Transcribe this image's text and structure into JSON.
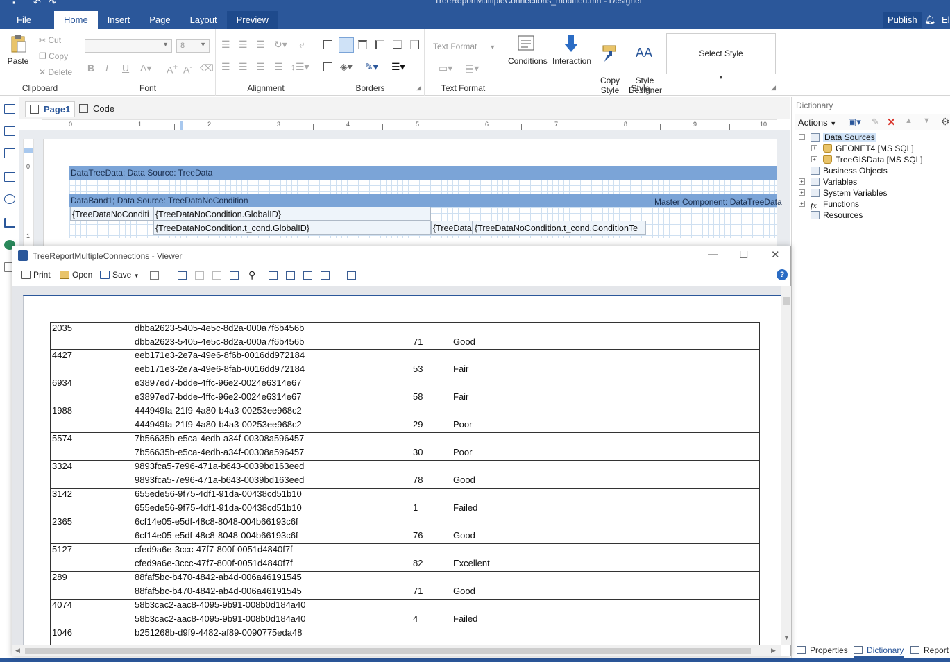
{
  "app": {
    "document_title": "TreeReportMultipleConnections_modified.mrt - Designer",
    "menu": [
      "File",
      "Home",
      "Insert",
      "Page",
      "Layout",
      "Preview"
    ],
    "publish": "Publish",
    "user_initials": "El"
  },
  "ribbon": {
    "clipboard": {
      "label": "Clipboard",
      "paste": "Paste",
      "cut": "Cut",
      "copy": "Copy",
      "delete": "Delete"
    },
    "font": {
      "label": "Font",
      "size": "8"
    },
    "alignment": {
      "label": "Alignment"
    },
    "borders": {
      "label": "Borders"
    },
    "text_format": {
      "label": "Text Format",
      "combo": "Text Format"
    },
    "style": {
      "label": "Style",
      "conditions": "Conditions",
      "interaction": "Interaction",
      "copy_style": "Copy\nStyle",
      "style_designer": "Style\nDesigner",
      "select_style": "Select Style"
    }
  },
  "designer": {
    "tabs": [
      "Page1",
      "Code"
    ],
    "ruler": [
      "0",
      "1",
      "2",
      "3",
      "4",
      "5",
      "6",
      "7",
      "8",
      "9",
      "10"
    ],
    "vruler": [
      "0",
      "1"
    ],
    "bands": {
      "tree": "DataTreeData; Data Source: TreeData",
      "databand": "DataBand1; Data Source: TreeDataNoCondition",
      "master": "Master Component: DataTreeData"
    },
    "fields": {
      "f1": "{TreeDataNoConditi",
      "f2": "{TreeDataNoCondition.GlobalID}",
      "f3": "{TreeDataNoCondition.t_cond.GlobalID}",
      "f4": "{TreeData",
      "f5": "{TreeDataNoCondition.t_cond.ConditionTe"
    }
  },
  "dictionary": {
    "title": "Dictionary",
    "actions": "Actions",
    "tree": {
      "data_sources": "Data Sources",
      "geonet": "GEONET4 [MS SQL]",
      "treegis": "TreeGISData [MS SQL]",
      "business_objects": "Business Objects",
      "variables": "Variables",
      "system_variables": "System Variables",
      "functions": "Functions",
      "resources": "Resources"
    },
    "bottom_tabs": [
      "Properties",
      "Dictionary",
      "Report"
    ]
  },
  "viewer": {
    "title": "TreeReportMultipleConnections - Viewer",
    "toolbar": {
      "print": "Print",
      "open": "Open",
      "save": "Save"
    },
    "rows": [
      {
        "id": "2035",
        "guid": "dbba2623-5405-4e5c-8d2a-000a7f6b456b",
        "guid2": "dbba2623-5405-4e5c-8d2a-000a7f6b456b",
        "score": "71",
        "condition": "Good"
      },
      {
        "id": "4427",
        "guid": "eeb171e3-2e7a-49e6-8f6b-0016dd972184",
        "guid2": "eeb171e3-2e7a-49e6-8fab-0016dd972184",
        "score": "53",
        "condition": "Fair"
      },
      {
        "id": "6934",
        "guid": "e3897ed7-bdde-4ffc-96e2-0024e6314e67",
        "guid2": "e3897ed7-bdde-4ffc-96e2-0024e6314e67",
        "score": "58",
        "condition": "Fair"
      },
      {
        "id": "1988",
        "guid": "444949fa-21f9-4a80-b4a3-00253ee968c2",
        "guid2": "444949fa-21f9-4a80-b4a3-00253ee968c2",
        "score": "29",
        "condition": "Poor"
      },
      {
        "id": "5574",
        "guid": "7b56635b-e5ca-4edb-a34f-00308a596457",
        "guid2": "7b56635b-e5ca-4edb-a34f-00308a596457",
        "score": "30",
        "condition": "Poor"
      },
      {
        "id": "3324",
        "guid": "9893fca5-7e96-471a-b643-0039bd163eed",
        "guid2": "9893fca5-7e96-471a-b643-0039bd163eed",
        "score": "78",
        "condition": "Good"
      },
      {
        "id": "3142",
        "guid": "655ede56-9f75-4df1-91da-00438cd51b10",
        "guid2": "655ede56-9f75-4df1-91da-00438cd51b10",
        "score": "1",
        "condition": "Failed"
      },
      {
        "id": "2365",
        "guid": "6cf14e05-e5df-48c8-8048-004b66193c6f",
        "guid2": "6cf14e05-e5df-48c8-8048-004b66193c6f",
        "score": "76",
        "condition": "Good"
      },
      {
        "id": "5127",
        "guid": "cfed9a6e-3ccc-47f7-800f-0051d4840f7f",
        "guid2": "cfed9a6e-3ccc-47f7-800f-0051d4840f7f",
        "score": "82",
        "condition": "Excellent"
      },
      {
        "id": "289",
        "guid": "88faf5bc-b470-4842-ab4d-006a46191545",
        "guid2": "88faf5bc-b470-4842-ab4d-006a46191545",
        "score": "71",
        "condition": "Good"
      },
      {
        "id": "4074",
        "guid": "58b3cac2-aac8-4095-9b91-008b0d184a40",
        "guid2": "58b3cac2-aac8-4095-9b91-008b0d184a40",
        "score": "4",
        "condition": "Failed"
      },
      {
        "id": "1046",
        "guid": "b251268b-d9f9-4482-af89-0090775eda48",
        "guid2": "",
        "score": "",
        "condition": ""
      }
    ]
  },
  "colors": {
    "accent": "#2b579a",
    "band": "#7ba4d7"
  }
}
